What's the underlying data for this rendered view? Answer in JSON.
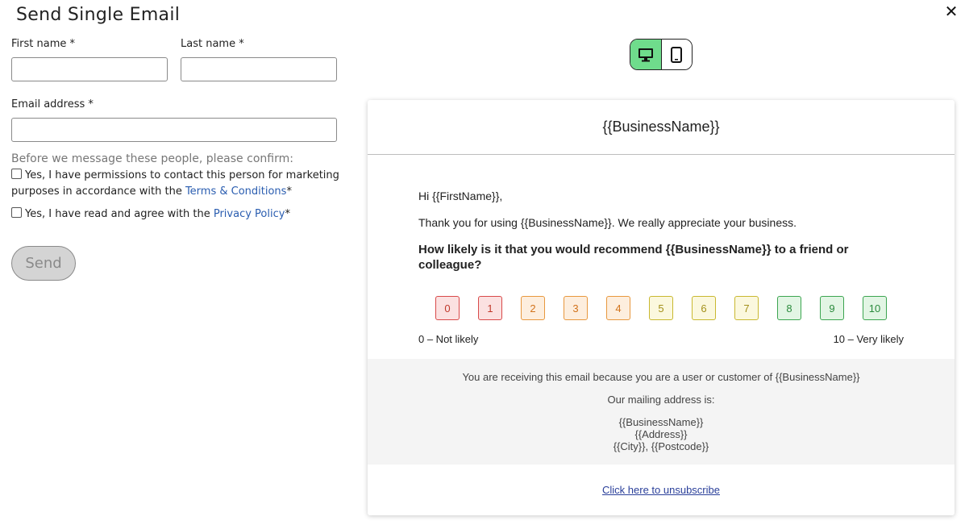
{
  "dialog": {
    "title": "Send Single Email",
    "close_label": "✕"
  },
  "form": {
    "first_name": {
      "label": "First name *",
      "value": "",
      "placeholder": ""
    },
    "last_name": {
      "label": "Last name *",
      "value": "",
      "placeholder": ""
    },
    "email": {
      "label": "Email address *",
      "value": "",
      "placeholder": ""
    },
    "confirm_prompt": "Before we message these people, please confirm:",
    "permission": {
      "text_before": "Yes, I have permissions to contact this person for marketing purposes in accordance with the ",
      "link": "Terms & Conditions",
      "suffix": "*",
      "checked": false
    },
    "privacy": {
      "text_before": "Yes, I have read and agree with the ",
      "link": "Privacy Policy",
      "suffix": "*",
      "checked": false
    },
    "send_label": "Send"
  },
  "preview_toggle": {
    "active": "desktop",
    "desktop_icon": "desktop-icon",
    "mobile_icon": "mobile-icon",
    "active_color": "#6fdc8c"
  },
  "email_preview": {
    "header": "{{BusinessName}}",
    "greeting": "Hi {{FirstName}},",
    "thanks": "Thank you for using {{BusinessName}}. We really appreciate your business.",
    "question": "How likely is it that you would recommend {{BusinessName}} to a friend or colleague?",
    "scores": [
      "0",
      "1",
      "2",
      "3",
      "4",
      "5",
      "6",
      "7",
      "8",
      "9",
      "10"
    ],
    "scale_low": "0 – Not likely",
    "scale_high": "10 – Very likely",
    "footer": {
      "reason": "You are receiving this email because you are a user or customer of {{BusinessName}}",
      "mailing_label": "Our mailing address is:",
      "address_line1": "{{BusinessName}}",
      "address_line2": "{{Address}}",
      "address_line3": "{{City}}, {{Postcode}}"
    },
    "unsubscribe": "Click here to unsubscribe"
  }
}
